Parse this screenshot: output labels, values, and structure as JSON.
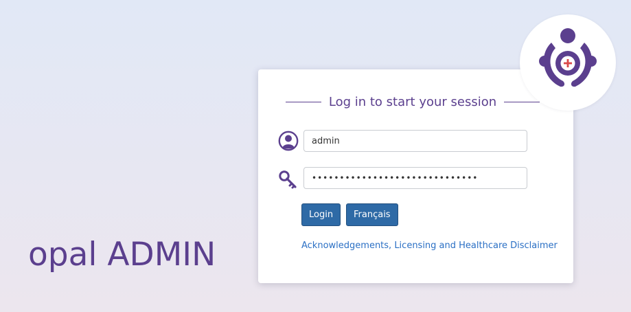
{
  "brand": {
    "text": "opal ADMIN"
  },
  "login": {
    "heading": "Log in to start your session",
    "username": {
      "value": "admin",
      "icon": "user-icon"
    },
    "password": {
      "value": "••••••••••••••••••••••••••••••",
      "icon": "key-icon"
    },
    "login_label": "Login",
    "language_label": "Français",
    "disclaimer_link": "Acknowledgements, Licensing and Healthcare Disclaimer"
  },
  "logo": {
    "icon": "opal-logo-icon"
  },
  "colors": {
    "accent": "#5b3f8e",
    "button": "#2e6aa6",
    "link": "#2a6fc4",
    "logo_cross": "#d94a4a"
  }
}
